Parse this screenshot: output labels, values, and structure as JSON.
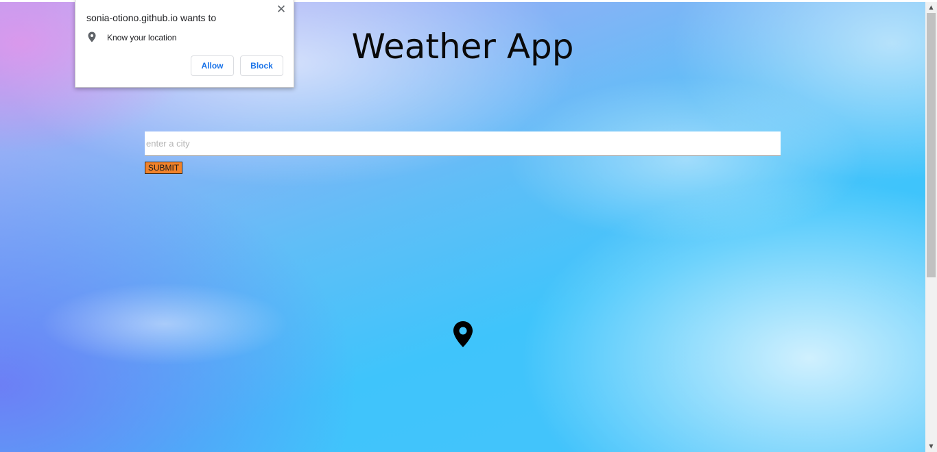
{
  "page": {
    "title": "Weather App"
  },
  "search": {
    "placeholder": "enter a city",
    "value": "",
    "submit_label": "SUBMIT"
  },
  "location_marker": {
    "icon": "map-marker-icon",
    "color": "#000000"
  },
  "permission_prompt": {
    "title": "sonia-otiono.github.io wants to",
    "permission_icon": "location-pin-icon",
    "permission_label": "Know your location",
    "allow_label": "Allow",
    "block_label": "Block",
    "close_icon": "close-icon",
    "button_text_color": "#1a73e8"
  },
  "colors": {
    "submit_button": "#f1822a",
    "sky_blue": "#3fc4fb",
    "sky_purple": "#b6a2f2"
  }
}
